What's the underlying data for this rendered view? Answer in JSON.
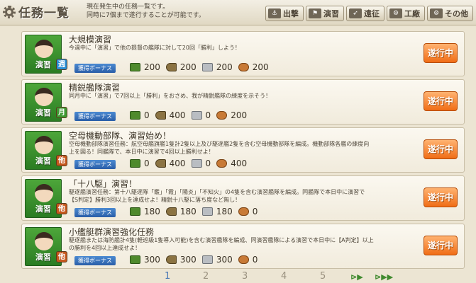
{
  "header": {
    "title": "任務一覧",
    "desc_line1": "現在発生中の任務一覧です。",
    "desc_line2": "同時に7個まで遂行することが可能です。"
  },
  "nav": [
    {
      "label": "出撃",
      "icon": "sortie-icon"
    },
    {
      "label": "演習",
      "icon": "exercise-icon"
    },
    {
      "label": "遠征",
      "icon": "expedition-icon"
    },
    {
      "label": "工廠",
      "icon": "factory-icon"
    },
    {
      "label": "その他",
      "icon": "other-icon"
    }
  ],
  "bonus_label": "獲得ボーナス",
  "quests": [
    {
      "category": "演習",
      "frequency": "週",
      "freq_color": "#2a8fd6",
      "title": "大規模演習",
      "desc": "今週中に「演習」で他の提督の艦隊に対して20回「勝利」しよう！",
      "rewards": {
        "fuel": "200",
        "ammo": "200",
        "steel": "200",
        "bauxite": "200"
      },
      "status": "遂行中"
    },
    {
      "category": "演習",
      "frequency": "月",
      "freq_color": "#3f9a34",
      "title": "精鋭艦隊演習",
      "desc": "同月中に「演習」で7回以上「勝利」をおさめ、我が精鋭艦隊の練度を示そう！",
      "rewards": {
        "fuel": "0",
        "ammo": "400",
        "steel": "0",
        "bauxite": "200"
      },
      "status": "遂行中"
    },
    {
      "category": "演習",
      "frequency": "他",
      "freq_color": "#c7581d",
      "title": "空母機動部隊、演習始め！",
      "desc": "空母機動部隊演習任務：航空母艦旗艦1隻計2隻以上及び駆逐艦2隻を含む空母機動部隊を編成。機動部隊各艦の練度向上を図る！同艦隊で、本日中に演習で4回以上勝利せよ！",
      "rewards": {
        "fuel": "0",
        "ammo": "400",
        "steel": "0",
        "bauxite": "400"
      },
      "status": "遂行中"
    },
    {
      "category": "演習",
      "frequency": "他",
      "freq_color": "#c7581d",
      "title": "「十八駆」演習！",
      "desc": "駆逐艦演習任務：第十八駆逐隊「霰」「霞」「陽炎」「不知火」の4隻を含む演習艦隊を編成。同艦隊で本日中に演習で【S判定】勝利3回以上を達成せよ！精鋭十八駆に落ち度など無し！",
      "rewards": {
        "fuel": "180",
        "ammo": "180",
        "steel": "180",
        "bauxite": "0"
      },
      "status": "遂行中"
    },
    {
      "category": "演習",
      "frequency": "他",
      "freq_color": "#c7581d",
      "title": "小艦艇群演習強化任務",
      "desc": "駆逐艦または海防艦計4隻(軽巡級1隻導入可能)を含む演習艦隊を編成、同演習艦隊による演習で本日中に【A判定】以上の勝利を4回以上達成せよ！",
      "rewards": {
        "fuel": "300",
        "ammo": "300",
        "steel": "300",
        "bauxite": "0"
      },
      "status": "遂行中"
    }
  ],
  "pagination": {
    "pages": [
      "1",
      "2",
      "3",
      "4",
      "5"
    ],
    "current": "1"
  },
  "colors": {
    "status": "#f06d16",
    "bonus": "#2a5ea8",
    "icon_bg": "#3a8f2e"
  }
}
